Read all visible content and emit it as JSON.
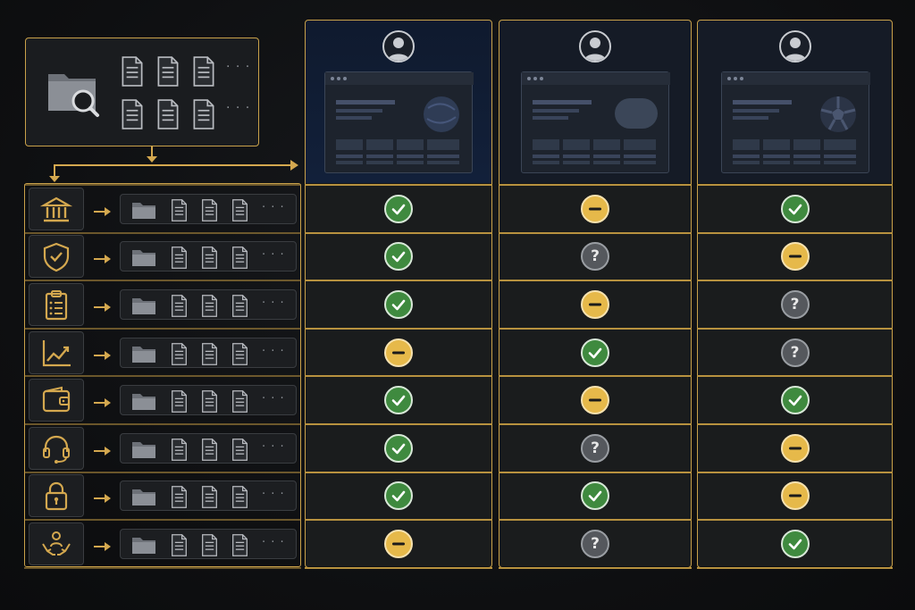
{
  "colors": {
    "accent": "#d4a84f",
    "ok": "#3f8a3f",
    "partial": "#e6b94a",
    "unknown": "#55585d"
  },
  "source": {
    "icons": [
      "folder-search-icon",
      "document-icon",
      "document-icon",
      "document-icon",
      "document-icon",
      "document-icon",
      "document-icon"
    ],
    "ellipsis": "· · ·"
  },
  "categories": [
    {
      "icon": "bank-icon",
      "files_ellipsis": "· · ·"
    },
    {
      "icon": "shield-check-icon",
      "files_ellipsis": "· · ·"
    },
    {
      "icon": "clipboard-list-icon",
      "files_ellipsis": "· · ·"
    },
    {
      "icon": "line-chart-icon",
      "files_ellipsis": "· · ·"
    },
    {
      "icon": "wallet-icon",
      "files_ellipsis": "· · ·"
    },
    {
      "icon": "headset-icon",
      "files_ellipsis": "· · ·"
    },
    {
      "icon": "lock-icon",
      "files_ellipsis": "· · ·"
    },
    {
      "icon": "hands-person-icon",
      "files_ellipsis": "· · ·"
    }
  ],
  "columns": [
    {
      "avatar": "user-avatar-icon",
      "visual": "sphere",
      "status": [
        "ok",
        "ok",
        "ok",
        "partial",
        "ok",
        "ok",
        "ok",
        "partial"
      ]
    },
    {
      "avatar": "user-avatar-icon",
      "visual": "pill",
      "status": [
        "partial",
        "unknown",
        "partial",
        "ok",
        "partial",
        "unknown",
        "ok",
        "unknown"
      ]
    },
    {
      "avatar": "user-avatar-icon",
      "visual": "ball",
      "status": [
        "ok",
        "partial",
        "unknown",
        "unknown",
        "ok",
        "partial",
        "partial",
        "ok"
      ]
    }
  ],
  "unknown_symbol": "?"
}
